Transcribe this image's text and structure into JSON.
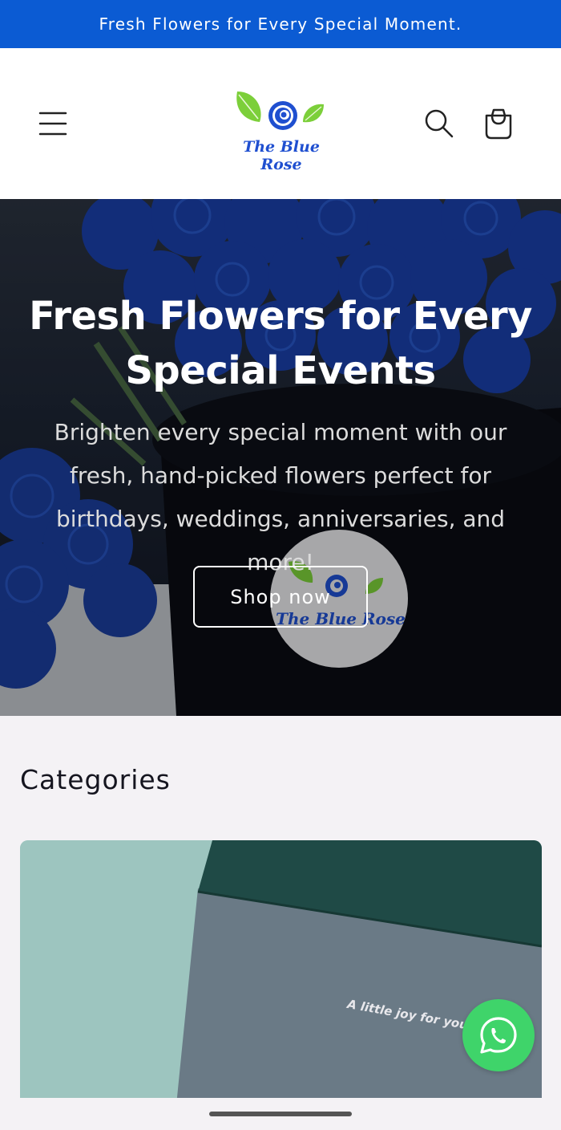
{
  "announcement": "Fresh Flowers for Every Special Moment.",
  "header": {
    "logo_text": "The Blue Rose",
    "icons": {
      "menu": "hamburger-menu-icon",
      "search": "search-icon",
      "cart": "cart-icon"
    }
  },
  "hero": {
    "title": "Fresh Flowers for Every Special Events",
    "text": "Brighten every special moment with our fresh, hand-picked flowers perfect for birthdays, weddings, anniversaries, and more!",
    "button_label": "Shop now",
    "badge_text": "The Blue Rose"
  },
  "categories": {
    "title": "Categories",
    "card_caption": "A little joy for you."
  },
  "colors": {
    "announcement_bg": "#0b5bd3",
    "logo_blue": "#1f4fd0",
    "leaf_green": "#7ccf3a",
    "whatsapp_green": "#3fd46a"
  }
}
